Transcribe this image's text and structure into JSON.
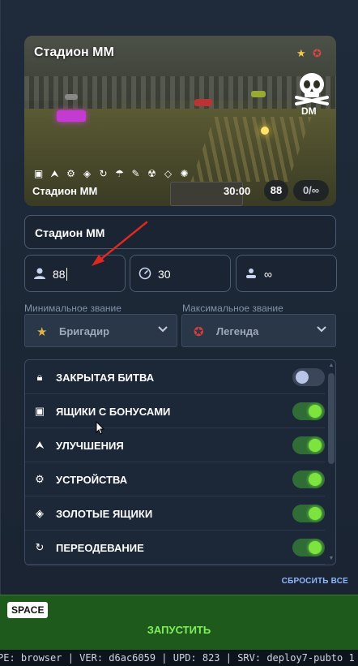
{
  "preview": {
    "title": "Стадион ММ",
    "mode": "DM",
    "map_name": "Стадион ММ",
    "time": "30:00",
    "players": "88",
    "score_limit": "0/∞",
    "feature_icons": [
      "crate-icon",
      "upgrades-icon",
      "gear-icon",
      "gold-box-icon",
      "refresh-icon",
      "parachute-icon",
      "wrench-icon",
      "nuclear-icon",
      "ruler-icon",
      "spark-icon"
    ]
  },
  "form": {
    "map_name_value": "Стадион ММ",
    "players_value": "88",
    "time_value": "30",
    "score_value": "∞"
  },
  "ranks": {
    "min_label": "Минимальное звание",
    "max_label": "Максимальное звание",
    "min_value": "Бригадир",
    "max_value": "Легенда"
  },
  "settings": [
    {
      "label": "ЗАКРЫТАЯ БИТВА",
      "icon": "lock-icon",
      "on": false
    },
    {
      "label": "ЯЩИКИ С БОНУСАМИ",
      "icon": "crate-icon",
      "on": true
    },
    {
      "label": "УЛУЧШЕНИЯ",
      "icon": "upgrades-icon",
      "on": true
    },
    {
      "label": "УСТРОЙСТВА",
      "icon": "gear-icon",
      "on": true
    },
    {
      "label": "ЗОЛОТЫЕ ЯЩИКИ",
      "icon": "gold-box-icon",
      "on": true
    },
    {
      "label": "ПЕРЕОДЕВАНИЕ",
      "icon": "refresh-icon",
      "on": true
    }
  ],
  "reset_label": "СБРОСИТЬ ВСЕ",
  "launch": {
    "key": "SPACE",
    "label": "ЗАПУСТИТЬ"
  },
  "footer": "PE: browser | VER: d6ac6059 | UPD: 823 | SRV: deploy7-pubto 1",
  "colors": {
    "toggle_on": "#7ce33f",
    "launch_bg": "#1f5a1d",
    "accent_link": "#8eb7ff"
  }
}
